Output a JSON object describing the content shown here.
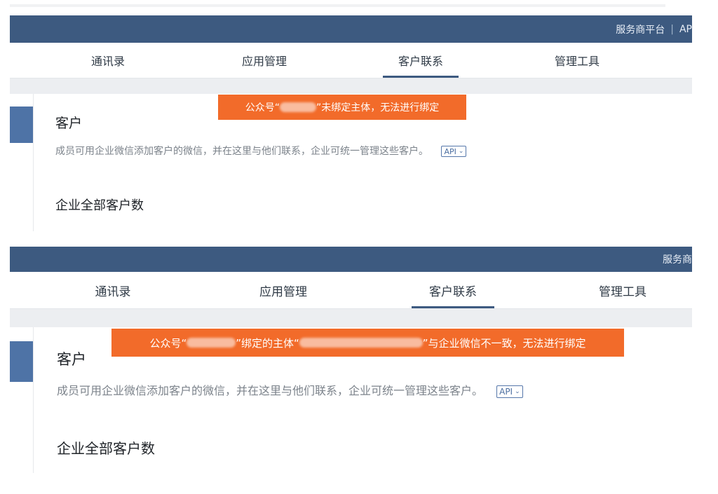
{
  "shot1": {
    "topbar": {
      "service_platform": "服务商平台",
      "separator": "|",
      "api": "AP"
    },
    "tabs": [
      "通讯录",
      "应用管理",
      "客户联系",
      "管理工具"
    ],
    "active_tab": "客户联系",
    "toast": {
      "part1": "公众号“",
      "part2": "”未绑定主体，无法进行绑定"
    },
    "page_title": "客户",
    "description": "成员可用企业微信添加客户的微信，并在这里与他们联系，企业可统一管理这些客户。",
    "api_badge": "API",
    "section_title": "企业全部客户数"
  },
  "shot2": {
    "topbar": {
      "service_platform": "服务商"
    },
    "tabs": [
      "通讯录",
      "应用管理",
      "客户联系",
      "管理工具"
    ],
    "active_tab": "客户联系",
    "toast": {
      "part1": "公众号“",
      "part2": "”绑定的主体“",
      "part3": "”与企业微信不一致，无法进行绑定"
    },
    "page_title": "客户",
    "description": "成员可用企业微信添加客户的微信，并在这里与他们联系，企业可统一管理这些客户。",
    "api_badge": "API",
    "section_title": "企业全部客户数"
  },
  "colors": {
    "topbar": "#3d5a80",
    "accent": "#4e73a6",
    "toast": "#f26b2a",
    "gray_band": "#eceef1"
  },
  "icons": {
    "api_chevron": "chevron-down-icon"
  }
}
